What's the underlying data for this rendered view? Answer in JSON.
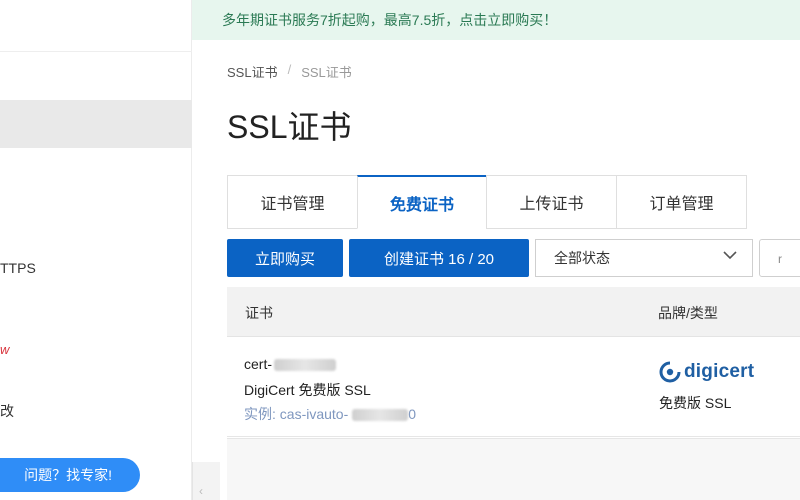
{
  "banner": {
    "text": "多年期证书服务7折起购，最高7.5折，点击立即购买！"
  },
  "sidebar": {
    "items": [
      {
        "label": "TTPS"
      },
      {
        "label": "w"
      },
      {
        "label": "改"
      }
    ],
    "expert_button": "问题？找专家!"
  },
  "breadcrumb": {
    "root": "SSL证书",
    "separator": "/",
    "current": "SSL证书"
  },
  "page": {
    "title": "SSL证书"
  },
  "tabs": [
    {
      "label": "证书管理"
    },
    {
      "label": "免费证书",
      "active": true
    },
    {
      "label": "上传证书"
    },
    {
      "label": "订单管理"
    }
  ],
  "toolbar": {
    "buy_button": "立即购买",
    "create_button": "创建证书 16 / 20",
    "status_filter": {
      "selected": "全部状态"
    },
    "extra": "r"
  },
  "table": {
    "columns": [
      "证书",
      "品牌/类型"
    ],
    "rows": [
      {
        "cert_name_prefix": "cert-",
        "cert_desc": "DigiCert 免费版 SSL",
        "instance_prefix": "实例: cas-ivauto-",
        "instance_suffix": "0",
        "brand": "digicert",
        "type": "免费版 SSL"
      }
    ]
  },
  "colors": {
    "primary": "#0b63c4",
    "banner_bg": "#e7f6ee",
    "banner_text": "#2b7a54",
    "expert_button": "#2f8df7",
    "digicert": "#1f5fa3"
  }
}
